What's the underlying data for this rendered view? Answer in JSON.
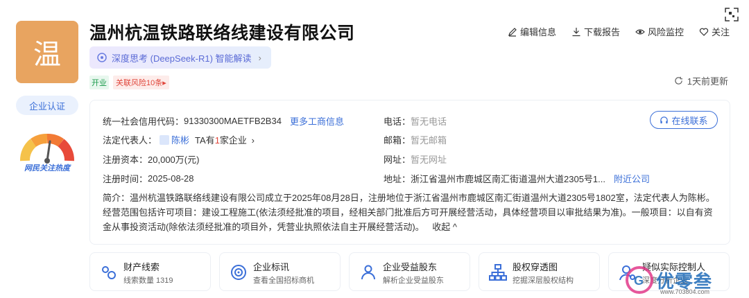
{
  "logo": {
    "char": "温",
    "color": "#e8a460"
  },
  "cert_button": "企业认证",
  "heat_label": "网民关注热度",
  "company": {
    "name": "温州杭温铁路联络线建设有限公司"
  },
  "ai": {
    "label": "深度思考 (DeepSeek-R1) 智能解读",
    "chevron": "›"
  },
  "tags": {
    "status": "开业",
    "risk": "关联风险10条",
    "risk_arrow": "▸"
  },
  "actions": [
    {
      "label": "编辑信息",
      "icon": "edit-icon"
    },
    {
      "label": "下载报告",
      "icon": "download-icon"
    },
    {
      "label": "风险监控",
      "icon": "eye-icon"
    },
    {
      "label": "关注",
      "icon": "heart-icon"
    }
  ],
  "updated": "1天前更新",
  "info": {
    "credit_code_label": "统一社会信用代码：",
    "credit_code": "91330300MAETFB2B34",
    "more_link": "更多工商信息",
    "legal_label": "法定代表人：",
    "legal_name": "陈彬",
    "legal_more": "TA有",
    "legal_count": "1",
    "legal_suffix": "家企业",
    "legal_arrow": "›",
    "capital_label": "注册资本：",
    "capital": "20,000万(元)",
    "date_label": "注册时间：",
    "date": "2025-08-28",
    "phone_label": "电话：",
    "phone": "暂无电话",
    "email_label": "邮箱：",
    "email": "暂无邮箱",
    "site_label": "网址：",
    "site": "暂无网址",
    "addr_label": "地址：",
    "addr": "浙江省温州市鹿城区南汇街道温州大道2305号1...",
    "nearby": "附近公司",
    "online_button": "在线联系",
    "intro_label": "简介：",
    "intro": "温州杭温铁路联络线建设有限公司成立于2025年08月28日，注册地位于浙江省温州市鹿城区南汇街道温州大道2305号1802室，法定代表人为陈彬。经营范围包括许可项目：建设工程施工(依法须经批准的项目，经相关部门批准后方可开展经营活动，具体经营项目以审批结果为准)。一般项目：以自有资金从事投资活动(除依法须经批准的项目外，凭营业执照依法自主开展经营活动)。",
    "collapse": "收起 ^"
  },
  "bottom_cards": [
    {
      "title": "财产线索",
      "sub": "线索数量 1319",
      "icon": "property-icon"
    },
    {
      "title": "企业标讯",
      "sub": "查看全国招标商机",
      "icon": "target-icon"
    },
    {
      "title": "企业受益股东",
      "sub": "解析企业受益股东",
      "icon": "shareholder-icon"
    },
    {
      "title": "股权穿透图",
      "sub": "挖掘深层股权结构",
      "icon": "equity-tree-icon"
    },
    {
      "title": "疑似实际控制人",
      "sub": "深度分析企业",
      "icon": "controller-icon"
    }
  ],
  "watermark": {
    "text": "优零叁",
    "url": "www.703804.com"
  },
  "colors": {
    "accent": "#3b6fd8",
    "open_green": "#1a9a4a",
    "risk_red": "#e0453a"
  }
}
